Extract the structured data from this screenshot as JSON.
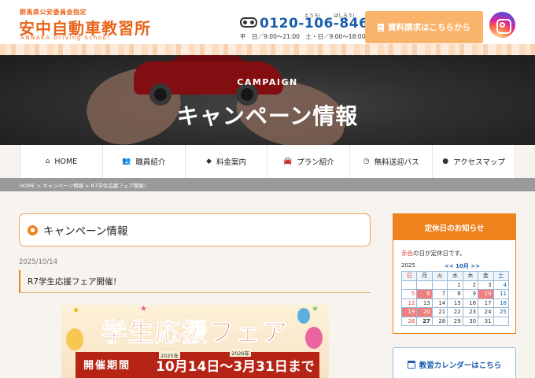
{
  "header": {
    "logo_sub": "群馬県公安委員会指定",
    "logo_main": "安中自動車教習所",
    "logo_en": "ANNAKA Driving School",
    "phone_ruby_1": "とうろ!",
    "phone_ruby_2": "はしろう!",
    "phone": "0120-106-846",
    "hours": "平　日／9:00～21:00　土・日／9:00～18:00",
    "request_button": "資料請求はこちらから"
  },
  "hero": {
    "subtitle": "CAMPAIGN",
    "title": "キャンペーン情報"
  },
  "nav": [
    {
      "icon": "home-icon",
      "glyph": "⌂",
      "label": "HOME"
    },
    {
      "icon": "users-icon",
      "glyph": "👥",
      "label": "職員紹介"
    },
    {
      "icon": "tag-icon",
      "glyph": "◆",
      "label": "料金案内"
    },
    {
      "icon": "car-icon",
      "glyph": "🚘",
      "label": "プラン紹介"
    },
    {
      "icon": "clock-icon",
      "glyph": "◷",
      "label": "無料送迎バス"
    },
    {
      "icon": "map-pin-icon",
      "glyph": "●",
      "label": "アクセスマップ"
    }
  ],
  "breadcrumb": "HOME > キャンペーン情報 > R7学生応援フェア開催！",
  "main": {
    "section_title": "キャンペーン情報",
    "post_date": "2025/10/14",
    "post_title": "R7学生応援フェア開催！",
    "banner": {
      "title": "学生応援フェア",
      "period_label": "開催期間",
      "year_start": "2025年",
      "year_end": "2026年",
      "dates": "10月14日～3月31日まで"
    }
  },
  "sidebar": {
    "holiday_title": "定休日のお知らせ",
    "note_red": "赤色",
    "note_rest": "の日が定休日です。",
    "cal_year": "2025",
    "cal_month": "<< 10月 >>",
    "weekdays": [
      "日",
      "月",
      "火",
      "水",
      "木",
      "金",
      "土"
    ],
    "rows": [
      [
        "",
        "",
        "",
        "1",
        "2",
        "3",
        "4"
      ],
      [
        "5",
        "6",
        "7",
        "8",
        "9",
        "10",
        "11"
      ],
      [
        "12",
        "13",
        "14",
        "15",
        "16",
        "17",
        "18"
      ],
      [
        "19",
        "20",
        "21",
        "22",
        "23",
        "24",
        "25"
      ],
      [
        "26",
        "27",
        "28",
        "29",
        "30",
        "31",
        ""
      ]
    ],
    "holidays": [
      "6",
      "10",
      "19",
      "20"
    ],
    "today": "27",
    "kyouma_button": "教習カレンダーはこちら"
  },
  "colors": {
    "accent": "#f0821e",
    "brand_blue": "#1a5dad",
    "holiday": "#f08080"
  }
}
